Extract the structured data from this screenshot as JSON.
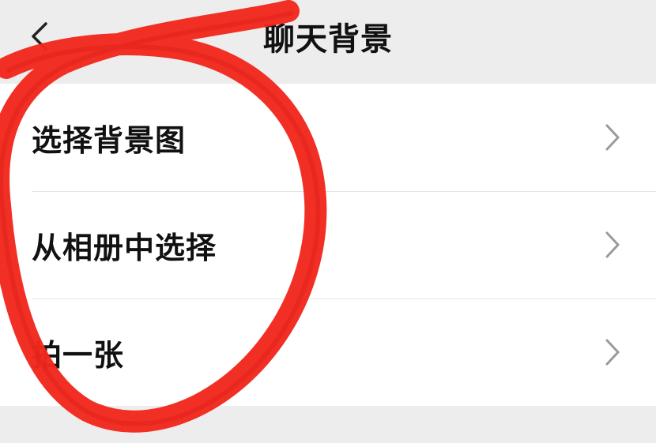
{
  "header": {
    "title": "聊天背景",
    "back_icon": "chevron-left-icon"
  },
  "menu": {
    "items": [
      {
        "label": "选择背景图",
        "icon": "chevron-right-icon"
      },
      {
        "label": "从相册中选择",
        "icon": "chevron-right-icon"
      },
      {
        "label": "拍一张",
        "icon": "chevron-right-icon"
      }
    ]
  },
  "colors": {
    "nav_background": "#ededed",
    "list_background": "#ffffff",
    "text": "#111111",
    "chevron": "#9a9a9a",
    "annotation_red": "#f2281e"
  },
  "annotation": {
    "type": "hand-drawn red circle",
    "encircles": [
      "选择背景图",
      "从相册中选择",
      "拍一张"
    ]
  }
}
